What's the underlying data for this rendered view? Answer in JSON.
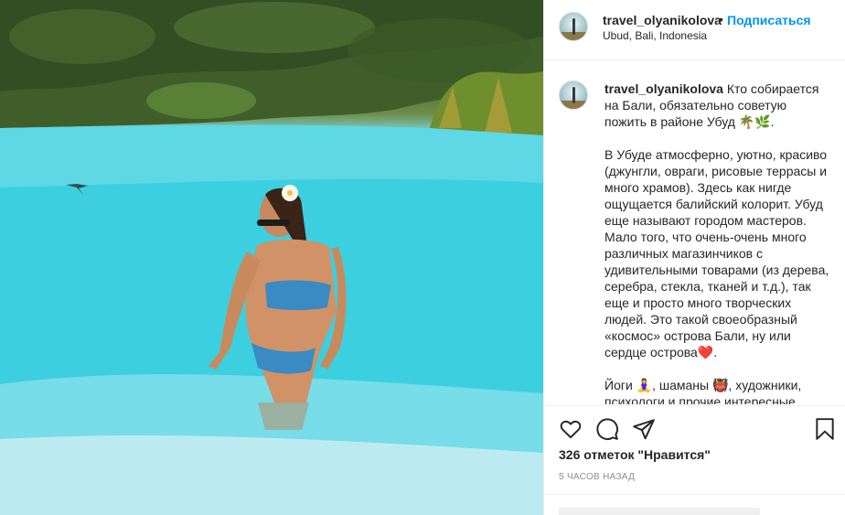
{
  "post": {
    "username": "travel_olyanikolova",
    "separator": "•",
    "follow_label": "Подписаться",
    "location": "Ubud, Bali, Indonesia"
  },
  "caption": {
    "username": "travel_olyanikolova",
    "text": " Кто собирается на Бали, обязательно советую пожить в районе Убуд 🌴🌿.\n\nВ Убуде атмосферно, уютно, красиво (джунгли, овраги, рисовые террасы и много храмов). Здесь как нигде ощущается балийский колорит. Убуд еще называют городом мастеров. Мало того, что очень-очень много различных магазинчиков с удивительными товарами (из дерева, серебра, стекла, тканей и т.д.), так еще и просто много творческих людей. Это такой своеобразный «космос» острова Бали, ну или сердце острова❤️.\n\nЙоги 🧘‍♀️, шаманы 👹, художники, психологи и прочие интересные"
  },
  "actions": {
    "like_icon": "heart-icon",
    "comment_icon": "comment-icon",
    "share_icon": "share-icon",
    "save_icon": "bookmark-icon"
  },
  "likes_text": "326 отметок \"Нравится\"",
  "time_text": "5 часов назад",
  "colors": {
    "accent": "#0095f6",
    "text": "#262626",
    "muted": "#8e8e8e",
    "border": "#efefef"
  }
}
